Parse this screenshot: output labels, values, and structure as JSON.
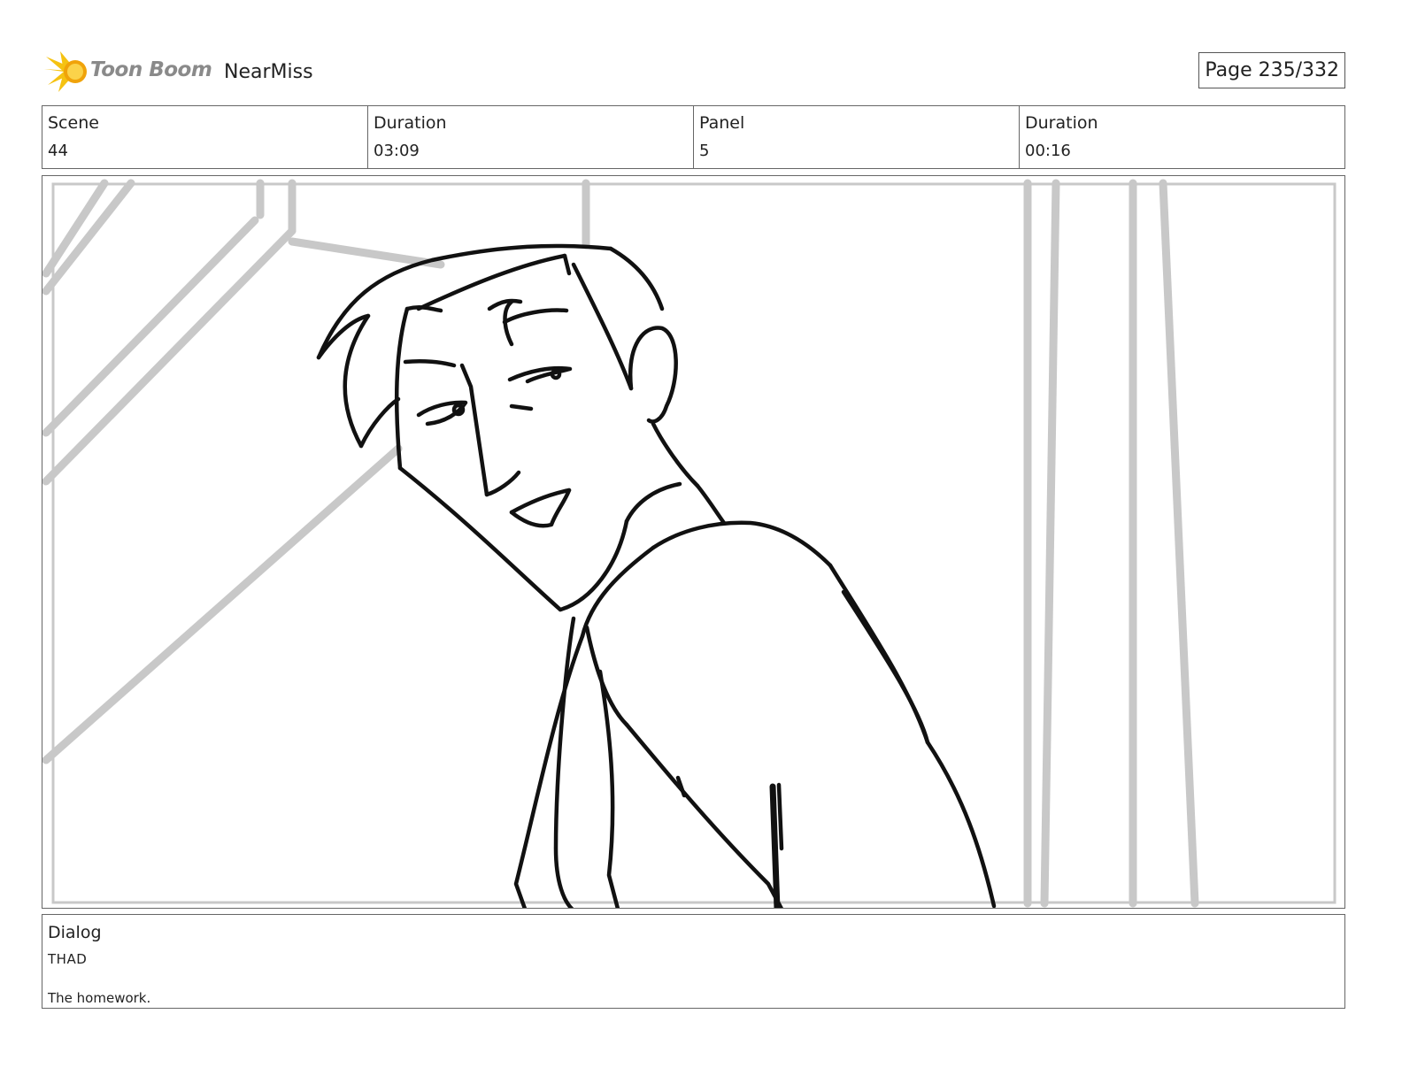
{
  "header": {
    "logo_text": "Toon Boom",
    "project_name": "NearMiss",
    "page_indicator": "Page 235/332"
  },
  "info": {
    "scene_label": "Scene",
    "scene_value": "44",
    "scene_duration_label": "Duration",
    "scene_duration_value": "03:09",
    "panel_label": "Panel",
    "panel_value": "5",
    "panel_duration_label": "Duration",
    "panel_duration_value": "00:16"
  },
  "dialog": {
    "label": "Dialog",
    "speaker": "THAD",
    "line": "The homework."
  },
  "colors": {
    "logo_yellow": "#f5c211",
    "logo_orange": "#f0a30a",
    "sketch_line": "#111111",
    "background_line": "#c8c8c8",
    "border": "#666666"
  }
}
